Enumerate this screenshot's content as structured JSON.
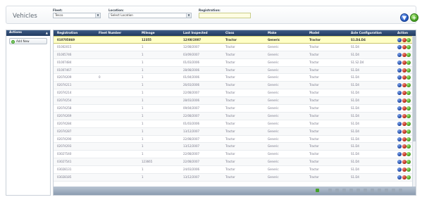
{
  "header": {
    "title": "Vehicles",
    "fleet": {
      "label": "Fleet:",
      "value": "Tesco"
    },
    "location": {
      "label": "Location:",
      "value": "Select Location"
    },
    "registration": {
      "label": "Registration:",
      "value": ""
    }
  },
  "sidebar": {
    "title": "Actions",
    "add_new": "Add New"
  },
  "grid": {
    "columns": [
      "Registration",
      "Fleet Number",
      "Mileage",
      "Last Inspected",
      "Class",
      "Make",
      "Model",
      "Axle Configuration",
      "Action"
    ],
    "rows": [
      {
        "registration": "010705869",
        "fleet_number": "",
        "mileage": "12355",
        "last_inspected": "12/08/2007",
        "class": "Tractor",
        "make": "Generic",
        "model": "Tractor",
        "axle": "S1.D4.D4",
        "selected": true
      },
      {
        "registration": "01002015",
        "fleet_number": "",
        "mileage": "1",
        "last_inspected": "12/08/2007",
        "class": "Tractor",
        "make": "Generic",
        "model": "Tractor",
        "axle": "S1.D4",
        "selected": false
      },
      {
        "registration": "01005746",
        "fleet_number": "",
        "mileage": "1",
        "last_inspected": "03/09/2007",
        "class": "Tractor",
        "make": "Generic",
        "model": "Tractor",
        "axle": "S1.D4",
        "selected": false
      },
      {
        "registration": "01007484",
        "fleet_number": "",
        "mileage": "1",
        "last_inspected": "01/03/2006",
        "class": "Tractor",
        "make": "Generic",
        "model": "Tractor",
        "axle": "S1.S2.D4",
        "selected": false
      },
      {
        "registration": "01007467",
        "fleet_number": "",
        "mileage": "1",
        "last_inspected": "28/08/2006",
        "class": "Tractor",
        "make": "Generic",
        "model": "Tractor",
        "axle": "S1.D4",
        "selected": false
      },
      {
        "registration": "02074209",
        "fleet_number": "0",
        "mileage": "1",
        "last_inspected": "01/04/2006",
        "class": "Tractor",
        "make": "Generic",
        "model": "Tractor",
        "axle": "S1.D4",
        "selected": false
      },
      {
        "registration": "02074211",
        "fleet_number": "",
        "mileage": "1",
        "last_inspected": "26/03/2006",
        "class": "Tractor",
        "make": "Generic",
        "model": "Tractor",
        "axle": "S1.D4",
        "selected": false
      },
      {
        "registration": "02074214",
        "fleet_number": "",
        "mileage": "1",
        "last_inspected": "22/08/2007",
        "class": "Tractor",
        "make": "Generic",
        "model": "Tractor",
        "axle": "S1.D4",
        "selected": false
      },
      {
        "registration": "02074254",
        "fleet_number": "",
        "mileage": "1",
        "last_inspected": "28/03/2006",
        "class": "Tractor",
        "make": "Generic",
        "model": "Tractor",
        "axle": "S1.D4",
        "selected": false
      },
      {
        "registration": "02074258",
        "fleet_number": "",
        "mileage": "1",
        "last_inspected": "09/04/2007",
        "class": "Tractor",
        "make": "Generic",
        "model": "Tractor",
        "axle": "S1.D4",
        "selected": false
      },
      {
        "registration": "02074269",
        "fleet_number": "",
        "mileage": "1",
        "last_inspected": "22/08/2007",
        "class": "Tractor",
        "make": "Generic",
        "model": "Tractor",
        "axle": "S1.D4",
        "selected": false
      },
      {
        "registration": "02074284",
        "fleet_number": "",
        "mileage": "1",
        "last_inspected": "01/03/2006",
        "class": "Tractor",
        "make": "Generic",
        "model": "Tractor",
        "axle": "S1.D4",
        "selected": false
      },
      {
        "registration": "02074287",
        "fleet_number": "",
        "mileage": "1",
        "last_inspected": "13/12/2007",
        "class": "Tractor",
        "make": "Generic",
        "model": "Tractor",
        "axle": "S1.D4",
        "selected": false
      },
      {
        "registration": "02074290",
        "fleet_number": "",
        "mileage": "1",
        "last_inspected": "22/08/2007",
        "class": "Tractor",
        "make": "Generic",
        "model": "Tractor",
        "axle": "S1.D4",
        "selected": false
      },
      {
        "registration": "02074293",
        "fleet_number": "",
        "mileage": "1",
        "last_inspected": "13/12/2007",
        "class": "Tractor",
        "make": "Generic",
        "model": "Tractor",
        "axle": "S1.D4",
        "selected": false
      },
      {
        "registration": "03027540",
        "fleet_number": "",
        "mileage": "1",
        "last_inspected": "22/08/2007",
        "class": "Tractor",
        "make": "Generic",
        "model": "Tractor",
        "axle": "S1.D4",
        "selected": false
      },
      {
        "registration": "03027541",
        "fleet_number": "",
        "mileage": "123665",
        "last_inspected": "22/08/2007",
        "class": "Tractor",
        "make": "Generic",
        "model": "Tractor",
        "axle": "S1.D4",
        "selected": false
      },
      {
        "registration": "03028131",
        "fleet_number": "",
        "mileage": "1",
        "last_inspected": "24/03/2006",
        "class": "Tractor",
        "make": "Generic",
        "model": "Tractor",
        "axle": "S1.D4",
        "selected": false
      },
      {
        "registration": "03028185",
        "fleet_number": "",
        "mileage": "1",
        "last_inspected": "13/12/2007",
        "class": "Tractor",
        "make": "Generic",
        "model": "Tractor",
        "axle": "S1.D4",
        "selected": false
      }
    ]
  },
  "icons": {
    "filter": "filter-icon",
    "add": "add-icon",
    "view": "view-icon",
    "delete": "delete-icon",
    "edit": "edit-icon"
  },
  "colors": {
    "header_bar": "#203a60",
    "selected_row": "#ffffc6",
    "pager_bar": "#8b9bb0"
  }
}
